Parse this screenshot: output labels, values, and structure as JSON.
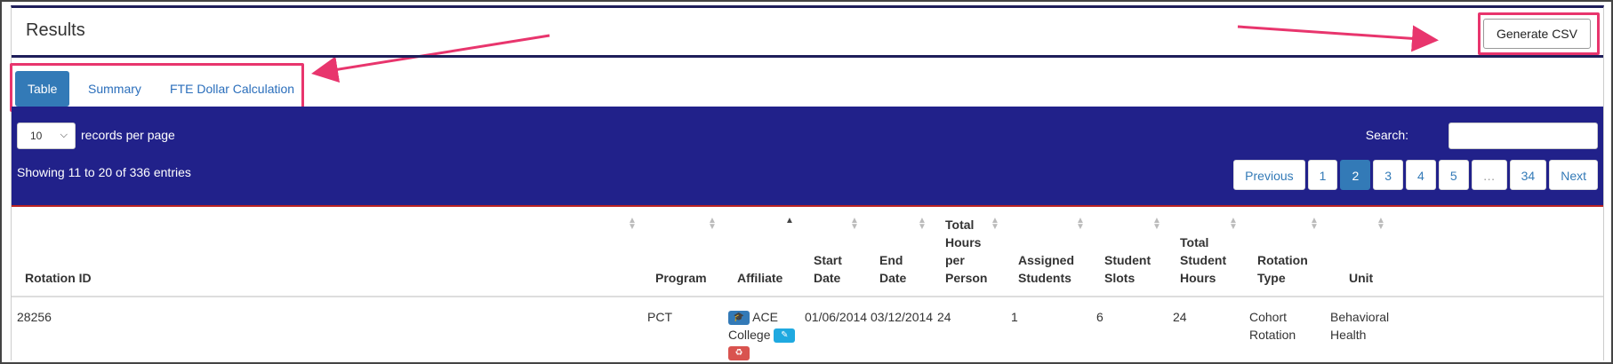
{
  "panel": {
    "title": "Results",
    "csv_label": "Generate CSV"
  },
  "tabs": [
    {
      "label": "Table",
      "active": true
    },
    {
      "label": "Summary",
      "active": false
    },
    {
      "label": "FTE Dollar Calculation",
      "active": false
    }
  ],
  "controls": {
    "length_value": "10",
    "length_label": "records per page",
    "search_label": "Search:",
    "search_value": "",
    "info": "Showing 11 to 20 of 336 entries"
  },
  "pagination": {
    "previous": "Previous",
    "pages": [
      "1",
      "2",
      "3",
      "4",
      "5",
      "…",
      "34"
    ],
    "current": "2",
    "next": "Next"
  },
  "columns": {
    "rotation_id": "Rotation ID",
    "program": "Program",
    "affiliate": "Affiliate",
    "start_date": [
      "Start",
      "Date"
    ],
    "end_date": [
      "End",
      "Date"
    ],
    "total_hours": [
      "Total",
      "Hours",
      "per",
      "Person"
    ],
    "assigned_students": [
      "Assigned",
      "Students"
    ],
    "student_slots": [
      "Student",
      "Slots"
    ],
    "total_student_hours": [
      "Total",
      "Student",
      "Hours"
    ],
    "rotation_type": [
      "Rotation",
      "Type"
    ],
    "unit": "Unit"
  },
  "row": {
    "rotation_id": "28256",
    "program": "PCT",
    "affiliate_1": "ACE",
    "affiliate_2": "College",
    "start_date": "01/06/2014",
    "end_date": "03/12/2014",
    "total_hours": "24",
    "assigned_students": "1",
    "student_slots": "6",
    "total_student_hours": "24",
    "rotation_type_1": "Cohort",
    "rotation_type_2": "Rotation",
    "unit_1": "Behavioral",
    "unit_2": "Health"
  },
  "colors": {
    "accent": "#337ab7",
    "highlight": "#e8356d",
    "navy": "#21218a"
  }
}
